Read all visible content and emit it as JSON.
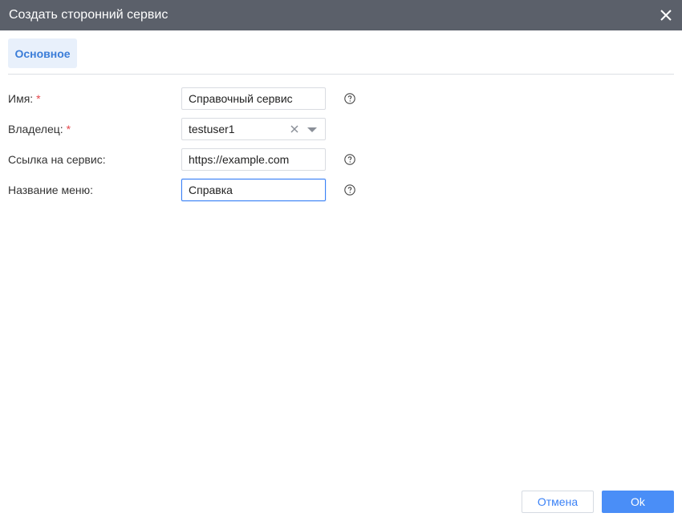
{
  "dialog": {
    "title": "Создать сторонний сервис",
    "close_icon": "close-icon"
  },
  "tabs": [
    {
      "label": "Основное",
      "active": true
    }
  ],
  "form": {
    "name": {
      "label": "Имя:",
      "required_mark": "*",
      "value": "Справочный сервис"
    },
    "owner": {
      "label": "Владелец:",
      "required_mark": "*",
      "value": "testuser1"
    },
    "link": {
      "label": "Ссылка на сервис:",
      "value": "https://example.com"
    },
    "menu_name": {
      "label": "Название меню:",
      "value": "Справка"
    }
  },
  "buttons": {
    "cancel": "Отмена",
    "ok": "Ok"
  },
  "colors": {
    "titlebar": "#5b606a",
    "accent": "#4a8ef7",
    "tab_bg": "#e8f0fb",
    "tab_text": "#3b7dd8",
    "required": "#e5484d"
  }
}
